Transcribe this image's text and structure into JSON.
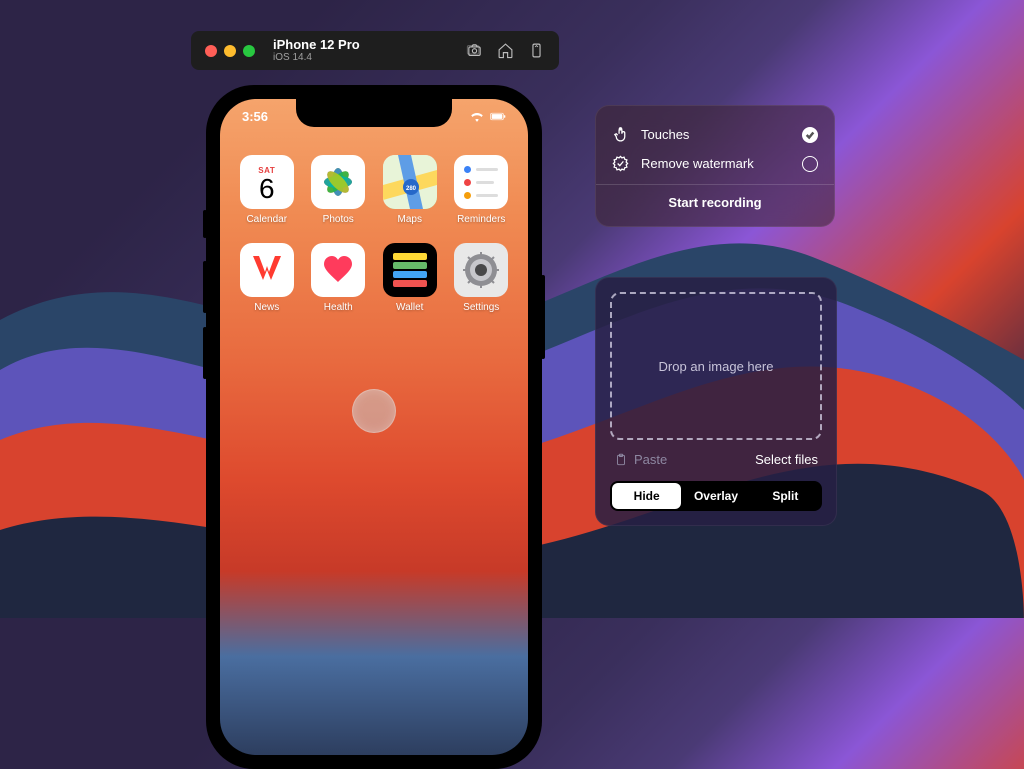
{
  "titlebar": {
    "device_name": "iPhone 12 Pro",
    "os_version": "iOS 14.4"
  },
  "phone": {
    "time": "3:56",
    "calendar": {
      "day": "SAT",
      "date": "6"
    },
    "apps": [
      {
        "label": "Calendar"
      },
      {
        "label": "Photos"
      },
      {
        "label": "Maps"
      },
      {
        "label": "Reminders"
      },
      {
        "label": "News"
      },
      {
        "label": "Health"
      },
      {
        "label": "Wallet"
      },
      {
        "label": "Settings"
      }
    ]
  },
  "recording": {
    "touches_label": "Touches",
    "watermark_label": "Remove watermark",
    "start_label": "Start recording"
  },
  "drop": {
    "zone_label": "Drop an image here",
    "paste_label": "Paste",
    "select_label": "Select files",
    "segments": {
      "hide": "Hide",
      "overlay": "Overlay",
      "split": "Split"
    }
  }
}
